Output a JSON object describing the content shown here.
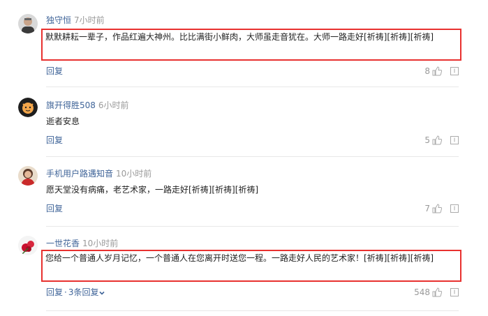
{
  "comments": [
    {
      "user": "独守恒",
      "time": "7小时前",
      "text": "默默耕耘一辈子，作品红遍大神州。比比满街小鲜肉，大师虽走音犹在。大师一路走好[祈祷][祈祷][祈祷]",
      "reply_label": "回复",
      "likes": "8",
      "highlighted": true
    },
    {
      "user": "旗开得胜508",
      "time": "6小时前",
      "text": "逝者安息",
      "reply_label": "回复",
      "likes": "5",
      "highlighted": false
    },
    {
      "user": "手机用户路遇知音",
      "time": "10小时前",
      "text": "愿天堂没有病痛，老艺术家，一路走好[祈祷][祈祷][祈祷]",
      "reply_label": "回复",
      "likes": "7",
      "highlighted": false
    },
    {
      "user": "一世花香",
      "time": "10小时前",
      "text": "您给一个普通人岁月记忆，一个普通人在您离开时送您一程。一路走好人民的艺术家！[祈祷][祈祷][祈祷]",
      "reply_label": "回复",
      "sep": "·",
      "replies_label": "3条回复",
      "likes": "548",
      "highlighted": true
    }
  ],
  "icons": {
    "like": "thumbs-up-icon",
    "report": "report-icon",
    "expand": "chevron-down-icon"
  },
  "colors": {
    "username": "#406599",
    "highlight_border": "#e8312f",
    "muted": "#999999"
  }
}
